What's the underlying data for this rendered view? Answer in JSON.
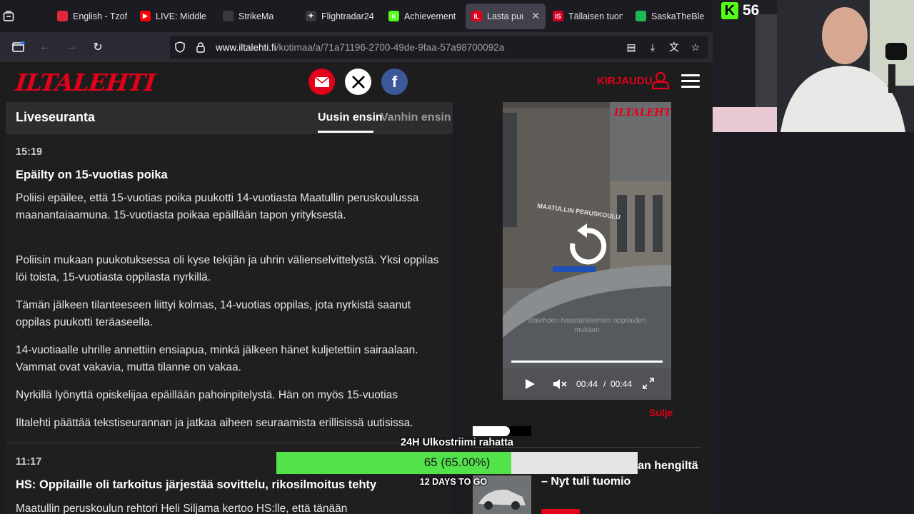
{
  "browser": {
    "tabs": [
      {
        "title": "English - Tzof",
        "fav_color": "#e2263b",
        "fav_text": ""
      },
      {
        "title": "LIVE: Middle",
        "fav_color": "#ff0000",
        "fav_text": "▶"
      },
      {
        "title": "StrikeMa",
        "fav_color": "#3a3a3a",
        "fav_text": ""
      },
      {
        "title": "Flightradar24",
        "fav_color": "#3a3a3a",
        "fav_text": "✈"
      },
      {
        "title": "Achievement",
        "fav_color": "#53fc18",
        "fav_text": "K"
      },
      {
        "title": "Lasta puuk",
        "fav_color": "#e3001b",
        "fav_text": "IL",
        "active": true
      },
      {
        "title": "Tällaisen tuon",
        "fav_color": "#d4002a",
        "fav_text": "IS"
      },
      {
        "title": "SaskaTheBle",
        "fav_color": "#1db954",
        "fav_text": ""
      }
    ],
    "url_domain": "www.iltalehti.fi",
    "url_path": "/kotimaa/a/71a71196-2700-49de-9faa-57a98700092a"
  },
  "header": {
    "logo": "ILTALEHTI",
    "login": "KIRJAUDU"
  },
  "live": {
    "title": "Liveseuranta",
    "sort_new": "Uusin ensin",
    "sort_old": "Vanhin ensin",
    "entry1": {
      "time": "15:19",
      "headline": "Epäilty on 15-vuotias poika",
      "paragraphs": [
        "Poliisi epäilee, että 15-vuotias poika puukotti 14-vuotiasta Maatullin peruskoulussa maanantaiaamuna. 15-vuotiasta poikaa epäillään tapon yrityksestä.",
        "Poliisin mukaan puukotuksessa oli kyse tekijän ja uhrin välienselvittelystä. Yksi oppilas löi toista, 15-vuotiasta oppilasta nyrkillä.",
        "Tämän jälkeen tilanteeseen liittyi kolmas, 14-vuotias oppilas, jota nyrkistä saanut oppilas puukotti teräaseella.",
        "14-vuotiaalle uhrille annettiin ensiapua, minkä jälkeen hänet kuljetettiin sairaalaan. Vammat ovat vakavia, mutta tilanne on vakaa.",
        "Nyrkillä lyönyttä opiskelijaa epäillään pahoinpitelystä. Hän on myös 15-vuotias",
        "Iltalehti päättää tekstiseurannan ja jatkaa aiheen seuraamista erillisissä uutisissa."
      ]
    },
    "entry2": {
      "time": "11:17",
      "headline": "HS: Oppilaille oli tarkoitus järjestää sovittelu, rikosilmoitus tehty",
      "paragraph": "Maatullin peruskoulun rehtori Heli Siljama kertoo HS:lle, että tänään"
    }
  },
  "video": {
    "logo": "ILTALEHTI",
    "caption": "Iltalehden haastattelemien oppilaiden mukaan",
    "current_time": "00:44",
    "separator": "/",
    "duration": "00:44",
    "progress": 1.0,
    "close": "Sulje"
  },
  "right_article": {
    "headline": "ski ajoi pariskunnan hengiltä – Nyt tuli tuomio"
  },
  "stream": {
    "viewer_count": "56",
    "goal_title": "24H Ulkostriimi rahatta",
    "goal_label": "65 (65.00%)",
    "goal_fraction": 0.65,
    "goal_days": "12 DAYS TO GO",
    "goal_color": "#53e24a"
  }
}
